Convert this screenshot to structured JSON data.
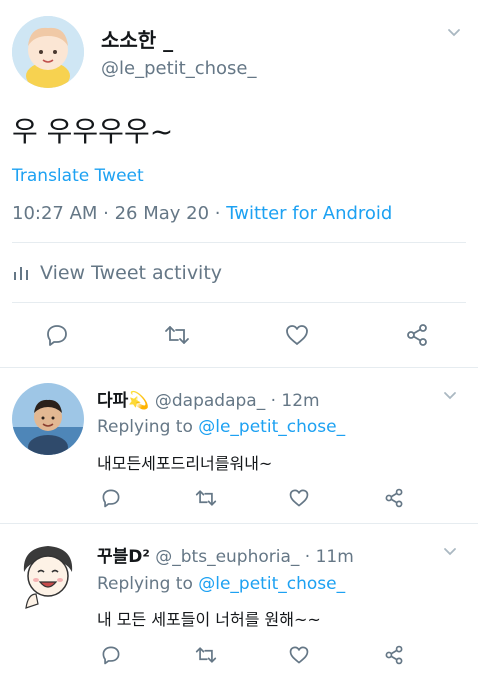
{
  "tweet": {
    "author_name": "소소한 _",
    "author_handle": "@le_petit_chose_",
    "text": "우 우우우우~",
    "translate_label": "Translate Tweet",
    "time_date": "10:27 AM · 26 May 20 · ",
    "source": "Twitter for Android",
    "activity_label": "View Tweet activity"
  },
  "replies": [
    {
      "name": "다파",
      "name_emoji": "💫",
      "handle": "@dapadapa_",
      "time": " · 12m",
      "replying_prefix": "Replying to ",
      "replying_to": "@le_petit_chose_",
      "text": "내모든세포드리너를워내~"
    },
    {
      "name": "꾸블D²",
      "handle": "@_bts_euphoria_",
      "time": " · 11m",
      "replying_prefix": "Replying to ",
      "replying_to": "@le_petit_chose_",
      "text": "내 모든 세포들이 너허를 원해~~"
    }
  ],
  "colors": {
    "accent": "#1da1f2",
    "secondary_text": "#657786",
    "divider": "#e6ecf0"
  },
  "icons": [
    "chevron-down-icon",
    "reply-icon",
    "retweet-icon",
    "like-icon",
    "share-icon",
    "activity-bars-icon"
  ]
}
